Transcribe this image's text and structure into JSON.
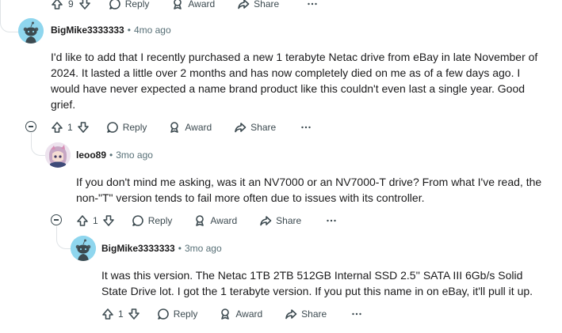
{
  "top_actions": {
    "upvotes": "9",
    "reply": "Reply",
    "award": "Award",
    "share": "Share"
  },
  "comments": [
    {
      "username": "BigMike3333333",
      "time": "4mo ago",
      "text": "I'd like to add that I recently purchased a new 1 terabyte Netac drive from eBay in late November of 2024. It lasted a little over 2 months and has now completely died on me as of a few days ago. I would have never expected a name brand product like this couldn't even last a single year. Good grief.",
      "upvotes": "1",
      "reply": "Reply",
      "award": "Award",
      "share": "Share",
      "avatar": "snoo-avatar"
    },
    {
      "username": "leoo89",
      "time": "3mo ago",
      "text": "If you don't mind me asking, was it an NV7000 or an NV7000-T drive? From what I've read, the non-\"T\" version tends to fail more often due to issues with its controller.",
      "upvotes": "1",
      "reply": "Reply",
      "award": "Award",
      "share": "Share",
      "avatar": "anime-avatar"
    },
    {
      "username": "BigMike3333333",
      "time": "3mo ago",
      "text": "It was this version. The Netac 1TB 2TB 512GB Internal SSD 2.5'' SATA III 6Gb/s Solid State Drive lot. I got the 1 terabyte version. If you put this name in on eBay, it'll pull it up.",
      "upvotes": "1",
      "reply": "Reply",
      "award": "Award",
      "share": "Share",
      "avatar": "snoo-avatar"
    }
  ],
  "colors": {
    "text": "#1a1a1b",
    "meta": "#576f76",
    "icon": "#3c4a50",
    "thread": "#dfe3e6",
    "avatar_bg": "#8fd6ee"
  }
}
